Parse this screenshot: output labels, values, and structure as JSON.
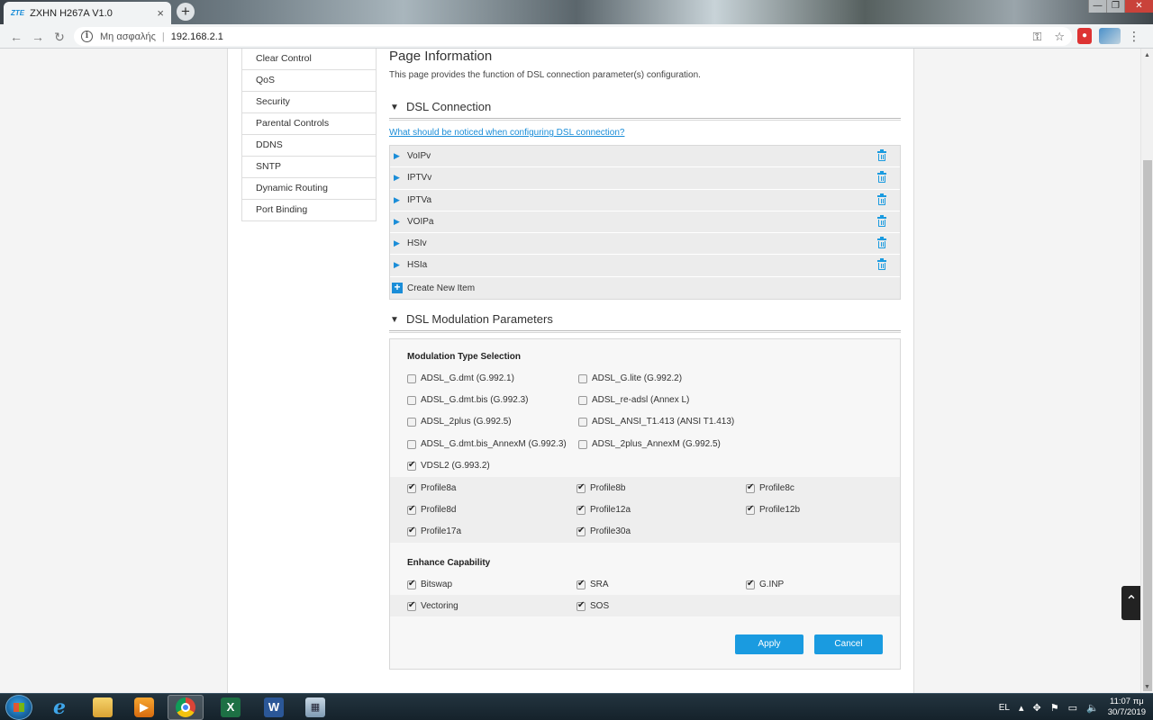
{
  "browser": {
    "tab_favicon": "ZTE",
    "tab_title": "ZXHN H267A V1.0",
    "tab_close": "×",
    "new_tab": "+",
    "window_controls": [
      "—",
      "❐",
      "✕"
    ],
    "security_label": "Μη ασφαλής",
    "url": "192.168.2.1",
    "icons": [
      "back-icon",
      "forward-icon",
      "reload-icon",
      "info-icon",
      "key-icon",
      "star-icon",
      "menu-icon"
    ]
  },
  "sidebar": {
    "items": [
      {
        "label": "Clear Control"
      },
      {
        "label": "QoS"
      },
      {
        "label": "Security"
      },
      {
        "label": "Parental Controls"
      },
      {
        "label": "DDNS"
      },
      {
        "label": "SNTP"
      },
      {
        "label": "Dynamic Routing"
      },
      {
        "label": "Port Binding"
      }
    ]
  },
  "page": {
    "title": "Page Information",
    "description": "This page provides the function of DSL connection parameter(s) configuration."
  },
  "dsl_connection": {
    "heading": "DSL Connection",
    "help_link": "What should be noticed when configuring DSL connection?",
    "connections": [
      {
        "name": "VoIPv"
      },
      {
        "name": "IPTVv"
      },
      {
        "name": "IPTVa"
      },
      {
        "name": "VOIPa"
      },
      {
        "name": "HSIv"
      },
      {
        "name": "HSIa"
      }
    ],
    "create_label": "Create New Item"
  },
  "dsl_modulation": {
    "heading": "DSL Modulation Parameters",
    "modulation_title": "Modulation Type Selection",
    "modulation_types": [
      {
        "label": "ADSL_G.dmt (G.992.1)",
        "checked": false
      },
      {
        "label": "ADSL_G.lite (G.992.2)",
        "checked": false
      },
      {
        "label": "ADSL_G.dmt.bis (G.992.3)",
        "checked": false
      },
      {
        "label": "ADSL_re-adsl (Annex L)",
        "checked": false
      },
      {
        "label": "ADSL_2plus (G.992.5)",
        "checked": false
      },
      {
        "label": "ADSL_ANSI_T1.413 (ANSI T1.413)",
        "checked": false
      },
      {
        "label": "ADSL_G.dmt.bis_AnnexM (G.992.3)",
        "checked": false
      },
      {
        "label": "ADSL_2plus_AnnexM (G.992.5)",
        "checked": false
      },
      {
        "label": "VDSL2 (G.993.2)",
        "checked": true
      }
    ],
    "profiles": [
      {
        "label": "Profile8a",
        "checked": true
      },
      {
        "label": "Profile8b",
        "checked": true
      },
      {
        "label": "Profile8c",
        "checked": true
      },
      {
        "label": "Profile8d",
        "checked": true
      },
      {
        "label": "Profile12a",
        "checked": true
      },
      {
        "label": "Profile12b",
        "checked": true
      },
      {
        "label": "Profile17a",
        "checked": true
      },
      {
        "label": "Profile30a",
        "checked": true
      }
    ],
    "enhance_title": "Enhance Capability",
    "enhance": [
      {
        "label": "Bitswap",
        "checked": true
      },
      {
        "label": "SRA",
        "checked": true
      },
      {
        "label": "G.INP",
        "checked": true
      },
      {
        "label": "Vectoring",
        "checked": true
      },
      {
        "label": "SOS",
        "checked": true
      }
    ],
    "apply_label": "Apply",
    "cancel_label": "Cancel"
  },
  "taskbar": {
    "apps": [
      "start-icon",
      "ie-icon",
      "explorer-icon",
      "media-player-icon",
      "chrome-icon",
      "excel-icon",
      "word-icon",
      "calculator-icon"
    ],
    "excel_letter": "X",
    "word_letter": "W",
    "ie_letter": "e",
    "language": "EL",
    "time": "11:07 πμ",
    "date": "30/7/2019"
  },
  "colors": {
    "accent": "#1a9be0",
    "link": "#1a8dd8"
  }
}
